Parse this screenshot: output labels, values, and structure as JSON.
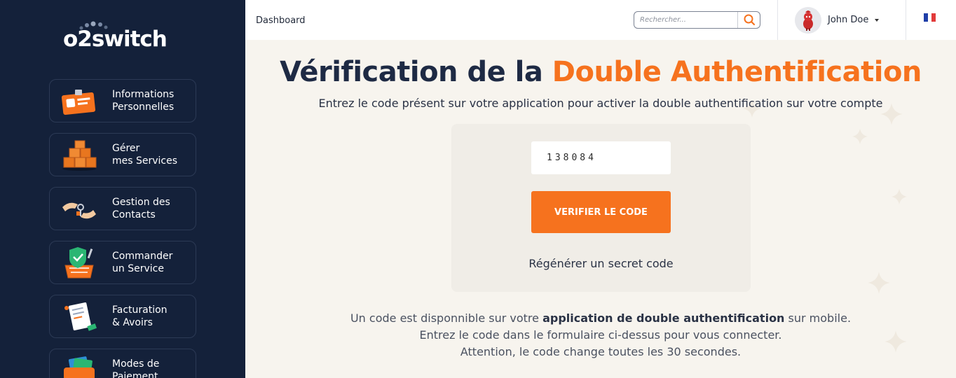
{
  "brand": {
    "logo_text": "o2switch"
  },
  "sidebar": {
    "items": [
      {
        "line1": "Informations",
        "line2": "Personnelles"
      },
      {
        "line1": "Gérer",
        "line2": "mes Services"
      },
      {
        "line1": "Gestion des",
        "line2": "Contacts"
      },
      {
        "line1": "Commander",
        "line2": "un Service"
      },
      {
        "line1": "Facturation",
        "line2": "& Avoirs"
      },
      {
        "line1": "Modes de",
        "line2": "Paiement"
      }
    ]
  },
  "header": {
    "breadcrumb": "Dashboard",
    "search_placeholder": "Rechercher...",
    "user_name": "John Doe",
    "language_flag": "fr-flag-icon"
  },
  "main": {
    "title_part1": "Vérification de la ",
    "title_accent": "Double Authentification",
    "subtitle": "Entrez le code présent sur votre application pour activer la double authentification sur votre compte",
    "code_value": "138084",
    "verify_button": "VERIFIER LE CODE",
    "regenerate_link": "Régénérer un secret code",
    "info_line1_pre": "Un code est disponnible sur votre ",
    "info_line1_bold": "application de double authentification",
    "info_line1_post": " sur mobile.",
    "info_line2": "Entrez le code dans le formulaire ci-dessus pour vous connecter.",
    "info_line3": "Attention, le code change toutes les 30 secondes."
  },
  "colors": {
    "sidebar_bg": "#14213a",
    "accent": "#f6721e",
    "page_bg": "#f7f4ee",
    "title": "#1e2a44"
  }
}
